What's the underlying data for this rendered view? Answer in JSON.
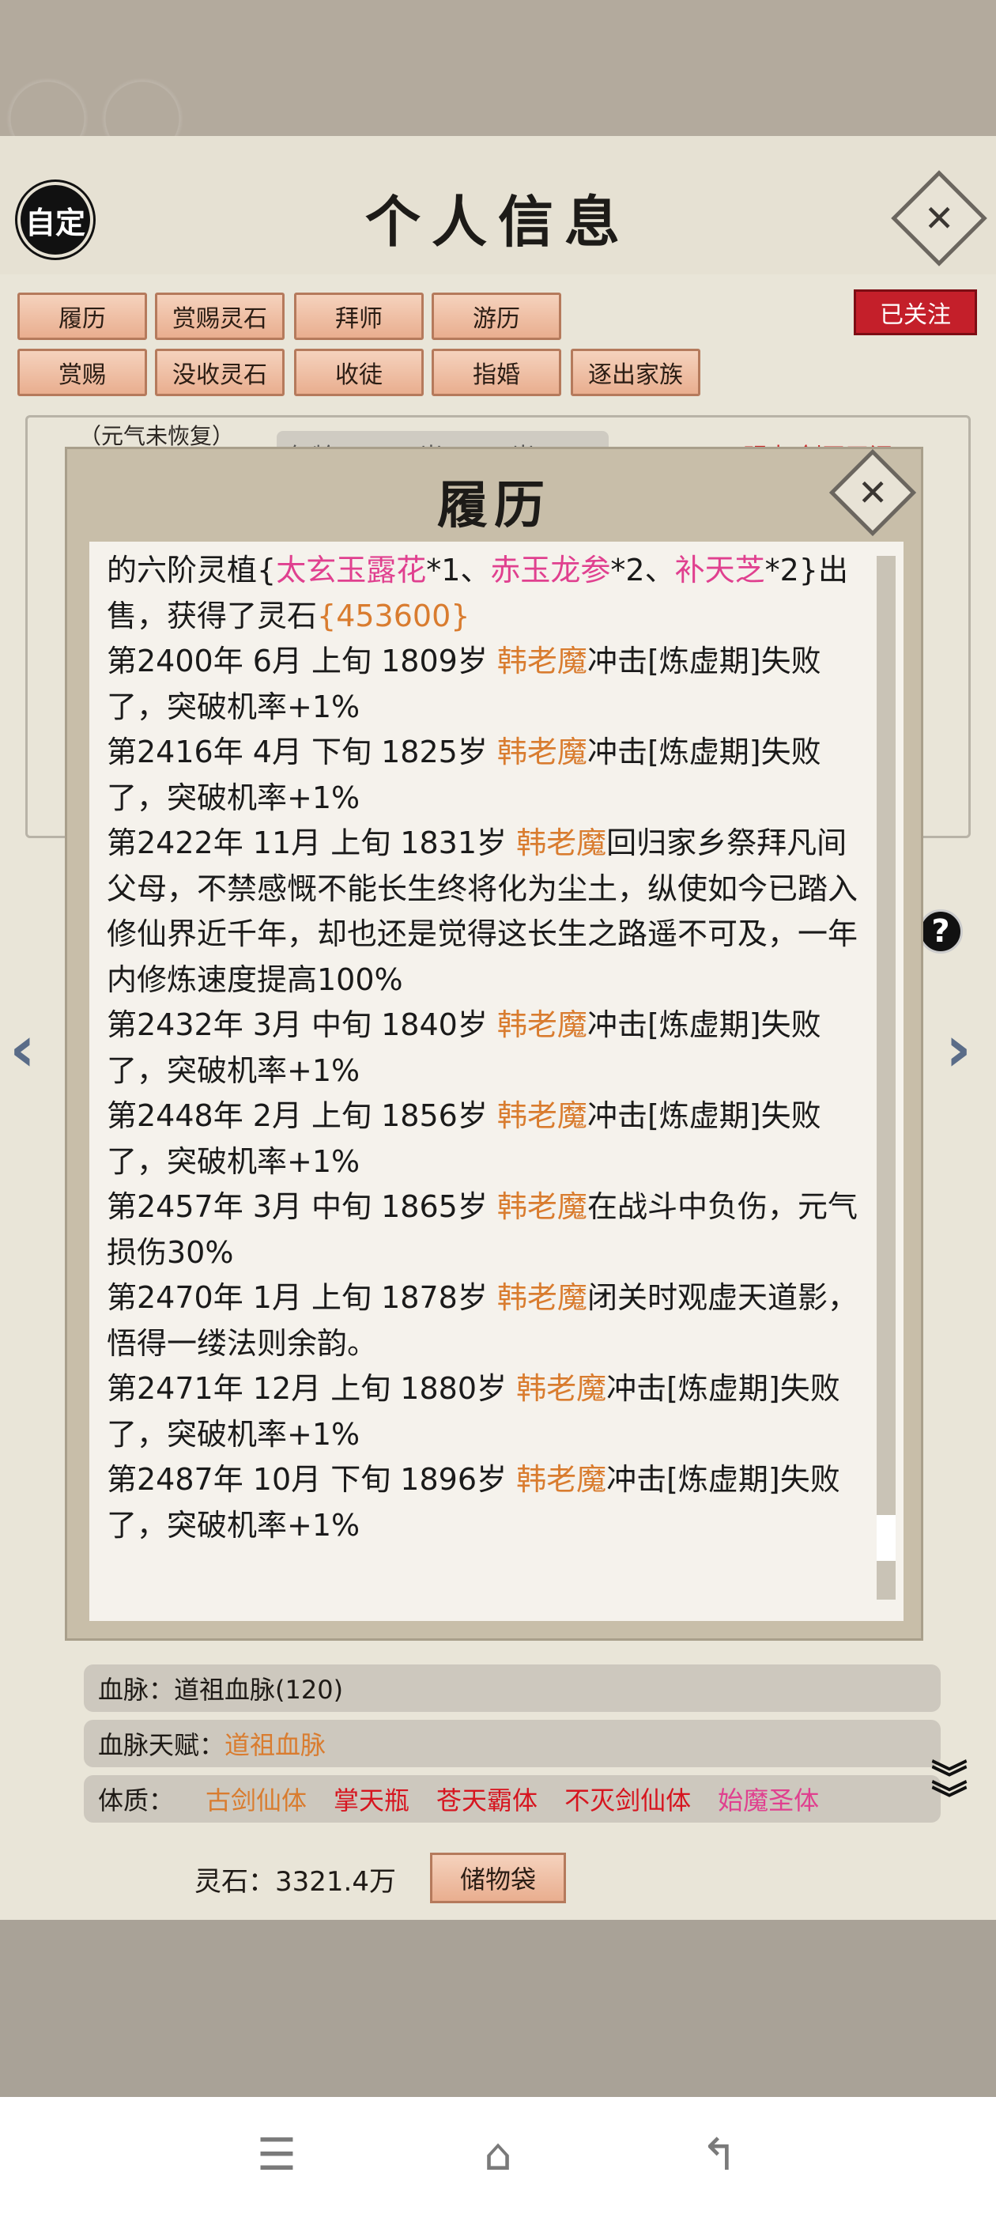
{
  "header": {
    "custom_label": "自定",
    "title": "个人信息",
    "close": "✕"
  },
  "actions": {
    "row1": [
      "履历",
      "赏赐灵石",
      "拜师",
      "游历"
    ],
    "row2": [
      "赏赐",
      "没收灵石",
      "收徒",
      "指婚",
      "逐出家族"
    ],
    "follow": "已关注"
  },
  "profile": {
    "qi_note": "（元气未恢复）",
    "age_partial": "年龄：1896岁/7350岁",
    "red_partial": "明虎 剑王天问"
  },
  "modal": {
    "title": "履历",
    "close": "✕",
    "entries": [
      {
        "parts": [
          {
            "t": "的六阶灵植{",
            "c": ""
          },
          {
            "t": "太玄玉露花",
            "c": "pink"
          },
          {
            "t": "*1、",
            "c": ""
          },
          {
            "t": "赤玉龙参",
            "c": "pink"
          },
          {
            "t": "*2、",
            "c": ""
          },
          {
            "t": "补天芝",
            "c": "pink"
          },
          {
            "t": "*2}出售，获得了灵石",
            "c": ""
          },
          {
            "t": "{453600}",
            "c": "orange"
          }
        ]
      },
      {
        "parts": [
          {
            "t": "第2400年 6月 上旬  1809岁  ",
            "c": ""
          },
          {
            "t": "韩老魔",
            "c": "orange"
          },
          {
            "t": "冲击[炼虚期]失败了，突破机率+1%",
            "c": ""
          }
        ]
      },
      {
        "parts": [
          {
            "t": "第2416年 4月 下旬  1825岁  ",
            "c": ""
          },
          {
            "t": "韩老魔",
            "c": "orange"
          },
          {
            "t": "冲击[炼虚期]失败了，突破机率+1%",
            "c": ""
          }
        ]
      },
      {
        "parts": [
          {
            "t": "第2422年 11月 上旬 1831岁 ",
            "c": ""
          },
          {
            "t": "韩老魔",
            "c": "orange"
          },
          {
            "t": "回归家乡祭拜凡间父母，不禁感慨不能长生终将化为尘土，纵使如今已踏入修仙界近千年，却也还是觉得这长生之路遥不可及，一年内修炼速度提高100%",
            "c": ""
          }
        ]
      },
      {
        "parts": [
          {
            "t": "第2432年 3月 中旬  1840岁  ",
            "c": ""
          },
          {
            "t": "韩老魔",
            "c": "orange"
          },
          {
            "t": "冲击[炼虚期]失败了，突破机率+1%",
            "c": ""
          }
        ]
      },
      {
        "parts": [
          {
            "t": "第2448年 2月 上旬  1856岁  ",
            "c": ""
          },
          {
            "t": "韩老魔",
            "c": "orange"
          },
          {
            "t": "冲击[炼虚期]失败了，突破机率+1%",
            "c": ""
          }
        ]
      },
      {
        "parts": [
          {
            "t": "第2457年 3月 中旬  1865岁  ",
            "c": ""
          },
          {
            "t": "韩老魔",
            "c": "orange"
          },
          {
            "t": "在战斗中负伤，元气损伤30%",
            "c": ""
          }
        ]
      },
      {
        "parts": [
          {
            "t": "第2470年 1月  上旬   1878岁   ",
            "c": ""
          },
          {
            "t": "韩老魔",
            "c": "orange"
          },
          {
            "t": "闭关时观虚天道影，悟得一缕法则余韵。",
            "c": ""
          }
        ]
      },
      {
        "parts": [
          {
            "t": "第2471年 12月 上旬  1880岁  ",
            "c": ""
          },
          {
            "t": "韩老魔",
            "c": "orange"
          },
          {
            "t": "冲击[炼虚期]失败了，突破机率+1%",
            "c": ""
          }
        ]
      },
      {
        "parts": [
          {
            "t": "第2487年 10月 下旬  1896岁  ",
            "c": ""
          },
          {
            "t": "韩老魔",
            "c": "orange"
          },
          {
            "t": "冲击[炼虚期]失败了，突破机率+1%",
            "c": ""
          }
        ]
      }
    ]
  },
  "details": {
    "bloodline_label": "血脉：",
    "bloodline_value": "道祖血脉(120)",
    "talent_label": "血脉天赋：",
    "talent_value": "道祖血脉",
    "physique_label": "体质：",
    "physique": [
      {
        "name": "古剑仙体",
        "c": "orange"
      },
      {
        "name": "掌天瓶",
        "c": "red"
      },
      {
        "name": "苍天霸体",
        "c": "red"
      },
      {
        "name": "不灭剑仙体",
        "c": "red"
      },
      {
        "name": "始魔圣体",
        "c": "pink"
      }
    ]
  },
  "footer": {
    "spirit_stone": "灵石：3321.4万",
    "bag": "储物袋"
  },
  "colors": {
    "orange": "#d97c2f",
    "red": "#d6151f",
    "pink": "#e0408f",
    "accent_button": "#e9ae8f"
  }
}
